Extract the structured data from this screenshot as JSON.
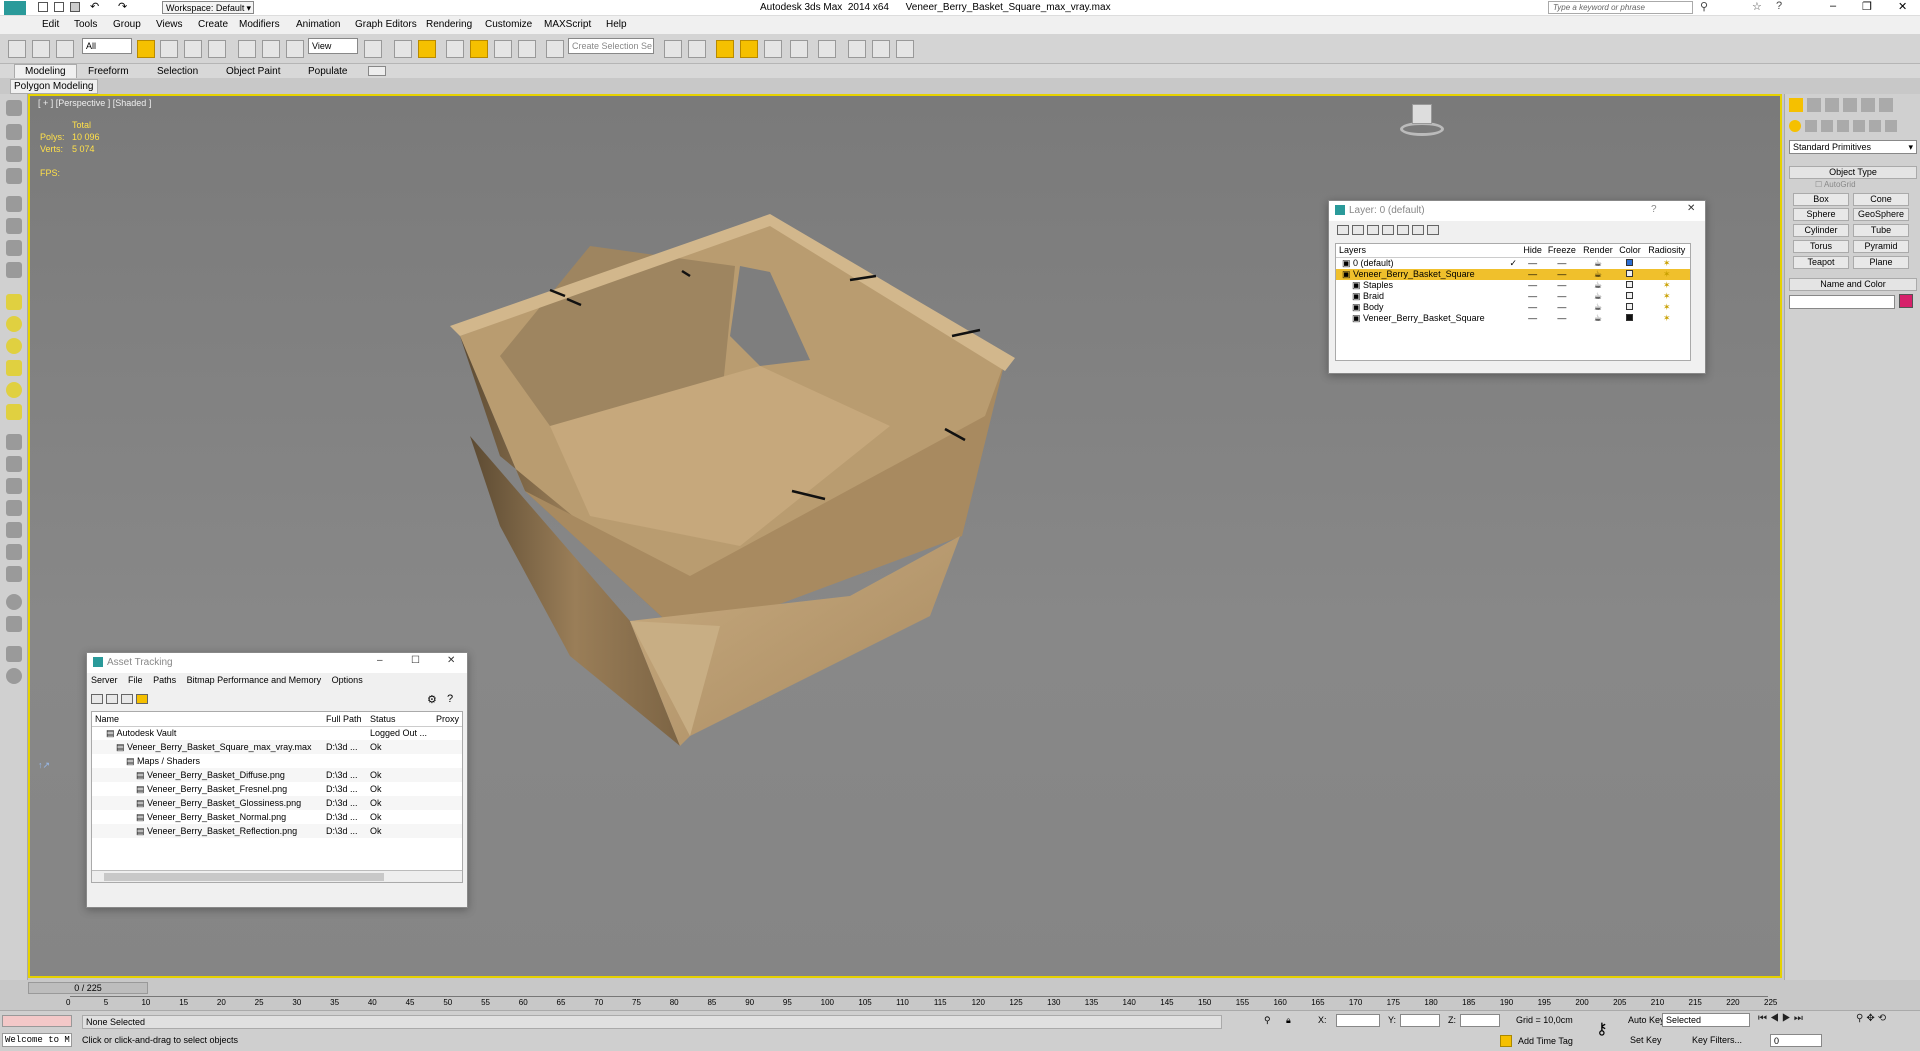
{
  "app": {
    "title": "Autodesk 3ds Max  2014 x64",
    "file": "Veneer_Berry_Basket_Square_max_vray.max",
    "workspace": "Workspace: Default",
    "search_placeholder": "Type a keyword or phrase"
  },
  "menu": [
    "Edit",
    "Tools",
    "Group",
    "Views",
    "Create",
    "Modifiers",
    "Animation",
    "Graph Editors",
    "Rendering",
    "Customize",
    "MAXScript",
    "Help"
  ],
  "toolbar": {
    "filter_value": "All",
    "refcoord_value": "View",
    "selection_set_placeholder": "Create Selection Se"
  },
  "ribbon": {
    "tabs": [
      "Modeling",
      "Freeform",
      "Selection",
      "Object Paint",
      "Populate"
    ],
    "subtab": "Polygon Modeling"
  },
  "viewport": {
    "label": "[ + ] [Perspective ] [Shaded ]",
    "stats_header": "Total",
    "polys_label": "Polys:",
    "polys_value": "10 096",
    "verts_label": "Verts:",
    "verts_value": "5 074",
    "fps_label": "FPS:"
  },
  "layer_window": {
    "title": "Layer: 0 (default)",
    "columns": [
      "Layers",
      "Hide",
      "Freeze",
      "Render",
      "Color",
      "Radiosity"
    ],
    "rows": [
      {
        "name": "0 (default)",
        "indent": 0,
        "color": "#2b6fd6",
        "selected": false,
        "check": true
      },
      {
        "name": "Veneer_Berry_Basket_Square",
        "indent": 0,
        "color": "#f0f0f0",
        "selected": true,
        "check": false
      },
      {
        "name": "Staples",
        "indent": 1,
        "color": "#f0f0f0",
        "selected": false,
        "check": false
      },
      {
        "name": "Braid",
        "indent": 1,
        "color": "#f0f0f0",
        "selected": false,
        "check": false
      },
      {
        "name": "Body",
        "indent": 1,
        "color": "#f0f0f0",
        "selected": false,
        "check": false
      },
      {
        "name": "Veneer_Berry_Basket_Square",
        "indent": 1,
        "color": "#111111",
        "selected": false,
        "check": false
      }
    ]
  },
  "asset_window": {
    "title": "Asset Tracking",
    "menu": [
      "Server",
      "File",
      "Paths",
      "Bitmap Performance and Memory",
      "Options"
    ],
    "columns": [
      "Name",
      "Full Path",
      "Status",
      "Proxy"
    ],
    "rows": [
      {
        "name": "Autodesk Vault",
        "path": "",
        "status": "Logged Out ...",
        "indent": 0
      },
      {
        "name": "Veneer_Berry_Basket_Square_max_vray.max",
        "path": "D:\\3d ...",
        "status": "Ok",
        "indent": 1
      },
      {
        "name": "Maps / Shaders",
        "path": "",
        "status": "",
        "indent": 2
      },
      {
        "name": "Veneer_Berry_Basket_Diffuse.png",
        "path": "D:\\3d ...",
        "status": "Ok",
        "indent": 3
      },
      {
        "name": "Veneer_Berry_Basket_Fresnel.png",
        "path": "D:\\3d ...",
        "status": "Ok",
        "indent": 3
      },
      {
        "name": "Veneer_Berry_Basket_Glossiness.png",
        "path": "D:\\3d ...",
        "status": "Ok",
        "indent": 3
      },
      {
        "name": "Veneer_Berry_Basket_Normal.png",
        "path": "D:\\3d ...",
        "status": "Ok",
        "indent": 3
      },
      {
        "name": "Veneer_Berry_Basket_Reflection.png",
        "path": "D:\\3d ...",
        "status": "Ok",
        "indent": 3
      }
    ]
  },
  "command_panel": {
    "dropdown": "Standard Primitives",
    "object_type_header": "Object Type",
    "autogrid": "AutoGrid",
    "buttons": [
      "Box",
      "Cone",
      "Sphere",
      "GeoSphere",
      "Cylinder",
      "Tube",
      "Torus",
      "Pyramid",
      "Teapot",
      "Plane"
    ],
    "name_color_header": "Name and Color",
    "swatch_color": "#d6206a"
  },
  "timeline": {
    "frame": "0 / 225",
    "ticks": [
      "0",
      "5",
      "10",
      "15",
      "20",
      "25",
      "30",
      "35",
      "40",
      "45",
      "50",
      "55",
      "60",
      "65",
      "70",
      "75",
      "80",
      "85",
      "90",
      "95",
      "100",
      "105",
      "110",
      "115",
      "120",
      "125",
      "130",
      "135",
      "140",
      "145",
      "150",
      "155",
      "160",
      "165",
      "170",
      "175",
      "180",
      "185",
      "190",
      "195",
      "200",
      "205",
      "210",
      "215",
      "220",
      "225"
    ]
  },
  "status": {
    "listener": "Welcome to M",
    "selection": "None Selected",
    "prompt": "Click or click-and-drag to select objects",
    "x_label": "X:",
    "y_label": "Y:",
    "z_label": "Z:",
    "grid": "Grid = 10,0cm",
    "add_time_tag": "Add Time Tag",
    "auto_key": "Auto Key",
    "set_key": "Set Key",
    "selected": "Selected",
    "key_filters": "Key Filters...",
    "frame_field": "0"
  },
  "colors": {
    "accent": "#f5c000",
    "viewport_border": "#e6d200",
    "selected_row": "#f0c02c"
  }
}
